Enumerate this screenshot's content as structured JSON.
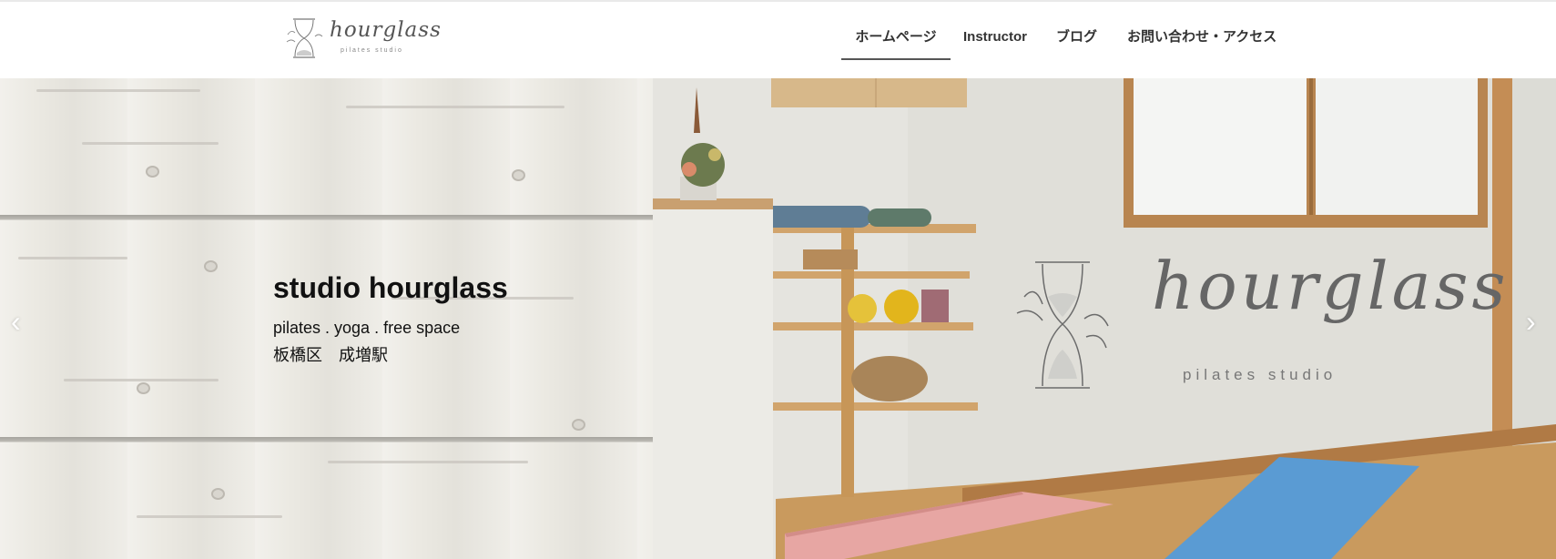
{
  "header": {
    "logo": {
      "script": "hourglass",
      "sub": "pilates studio"
    },
    "nav": [
      {
        "label": "ホームページ",
        "active": true
      },
      {
        "label": "Instructor",
        "active": false
      },
      {
        "label": "ブログ",
        "active": false
      },
      {
        "label": "お問い合わせ・アクセス",
        "active": false
      }
    ]
  },
  "hero": {
    "title": "studio hourglass",
    "subtitle": "pilates . yoga . free space",
    "location": "板橋区　成増駅",
    "photo": {
      "wall_logo_script": "hourglass",
      "wall_logo_sub": "pilates studio"
    },
    "prev_arrow": "‹",
    "next_arrow": "›"
  },
  "colors": {
    "nav_text": "#333333",
    "wood": "#ebe9e2",
    "wall": "#e0dfd9",
    "floor": "#c99a5e",
    "mat_pink": "#e7a6a3",
    "mat_blue": "#5a9bd3"
  }
}
